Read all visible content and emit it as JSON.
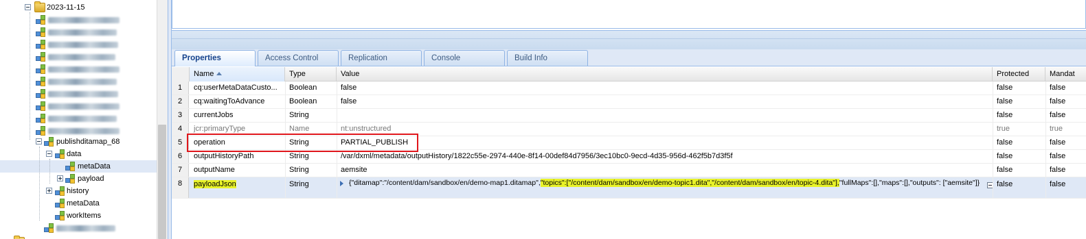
{
  "tree": {
    "date_folder": "2023-11-15",
    "workflow_node": "publishditamap_68",
    "children": {
      "data": "data",
      "metaData_selected": "metaData",
      "payload": "payload",
      "history": "history",
      "metaData": "metaData",
      "workItems": "workItems"
    },
    "icons": {
      "folder": "folder-icon",
      "node": "node-cube-icon"
    }
  },
  "tabs": [
    {
      "label": "Properties",
      "active": true
    },
    {
      "label": "Access Control",
      "active": false
    },
    {
      "label": "Replication",
      "active": false
    },
    {
      "label": "Console",
      "active": false
    },
    {
      "label": "Build Info",
      "active": false
    }
  ],
  "grid": {
    "columns": {
      "name": "Name",
      "type": "Type",
      "value": "Value",
      "protected": "Protected",
      "mandatory": "Mandat"
    },
    "sorted_by": "Name",
    "rows": [
      {
        "num": "1",
        "name": "cq:userMetaDataCusto...",
        "type": "Boolean",
        "value": "false",
        "protected": "false",
        "mandatory": "false"
      },
      {
        "num": "2",
        "name": "cq:waitingToAdvance",
        "type": "Boolean",
        "value": "false",
        "protected": "false",
        "mandatory": "false"
      },
      {
        "num": "3",
        "name": "currentJobs",
        "type": "String",
        "value": "",
        "protected": "false",
        "mandatory": "false"
      },
      {
        "num": "4",
        "name": "jcr:primaryType",
        "type": "Name",
        "value": "nt:unstructured",
        "protected": "true",
        "mandatory": "true"
      },
      {
        "num": "5",
        "name": "operation",
        "type": "String",
        "value": "PARTIAL_PUBLISH",
        "protected": "false",
        "mandatory": "false"
      },
      {
        "num": "6",
        "name": "outputHistoryPath",
        "type": "String",
        "value": "/var/dxml/metadata/outputHistory/1822c55e-2974-440e-8f14-00def84d7956/3ec10bc0-9ecd-4d35-956d-462f5b7d3f5f",
        "protected": "false",
        "mandatory": "false"
      },
      {
        "num": "7",
        "name": "outputName",
        "type": "String",
        "value": "aemsite",
        "protected": "false",
        "mandatory": "false"
      },
      {
        "num": "8",
        "name": "payloadJson",
        "type": "String",
        "protected": "false",
        "mandatory": "false",
        "value_parts": {
          "p1": "{\"ditamap\":\"/content/dam/sandbox/en/demo-map1.ditamap\",",
          "p2_highlighted": "\"topics\":[\"/content/dam/sandbox/en/demo-topic1.dita\",\"/content/dam/sandbox/en/topic-4.dita\"],",
          "p3": "\"fullMaps\":[],\"maps\":[],\"outputs\":",
          "p4": "[\"aemsite\"]}"
        }
      }
    ]
  },
  "colors": {
    "highlight": "#e8f229",
    "annotation_box": "#e0161b",
    "selection": "#dfe8f6",
    "border_blue": "#99bbe8"
  }
}
